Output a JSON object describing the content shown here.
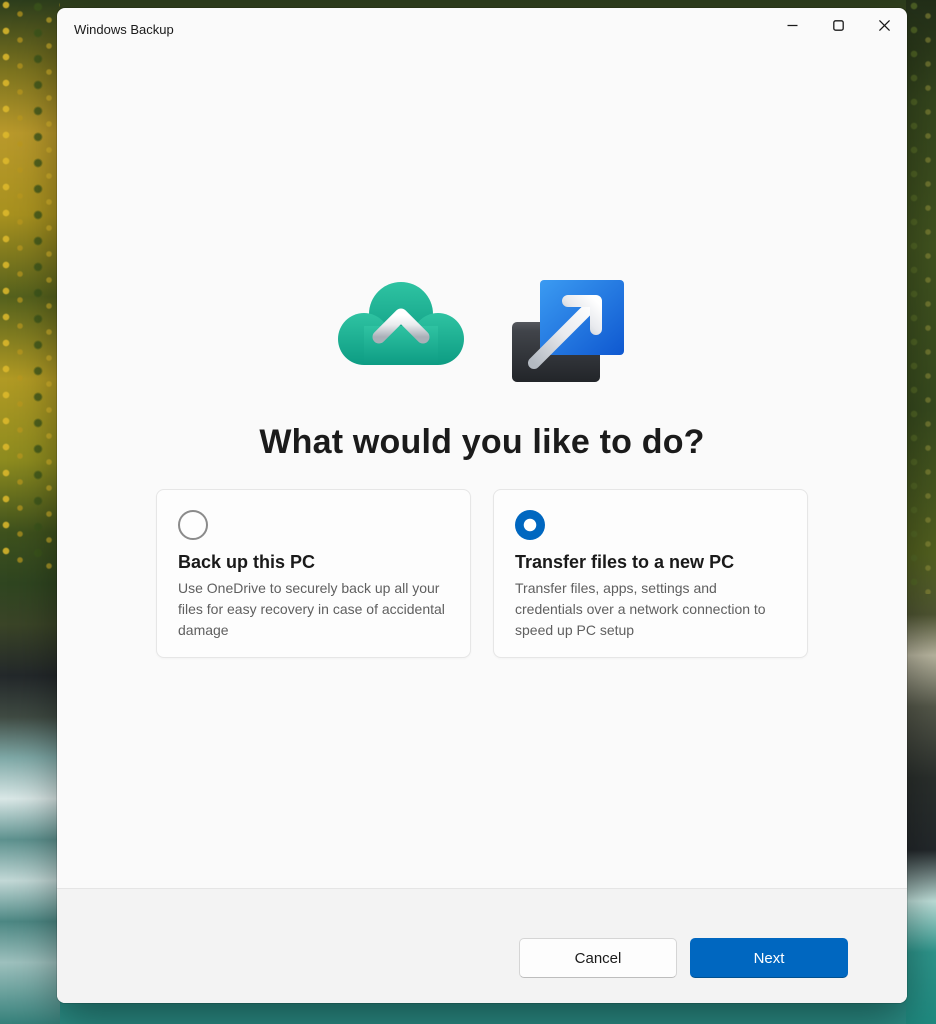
{
  "window": {
    "title": "Windows Backup",
    "controls": {
      "minimize": "minimize-icon",
      "maximize": "maximize-icon",
      "close": "close-icon"
    }
  },
  "main": {
    "heading": "What would you like to do?",
    "icons": [
      {
        "name": "cloud-backup-icon"
      },
      {
        "name": "transfer-pc-icon"
      }
    ],
    "options": [
      {
        "title": "Back up this PC",
        "description": "Use OneDrive to securely back up all your files for easy recovery in case of accidental damage",
        "selected": false
      },
      {
        "title": "Transfer files to a new PC",
        "description": "Transfer files, apps, settings and credentials over a network connection to speed up PC setup",
        "selected": true
      }
    ]
  },
  "footer": {
    "cancel_label": "Cancel",
    "next_label": "Next"
  },
  "colors": {
    "accent_blue": "#0067C0",
    "cloud_teal": "#16A78B",
    "transfer_blue": "#1E6EDC",
    "window_bg": "#FAFAFA",
    "footer_bg": "#F3F3F3"
  }
}
